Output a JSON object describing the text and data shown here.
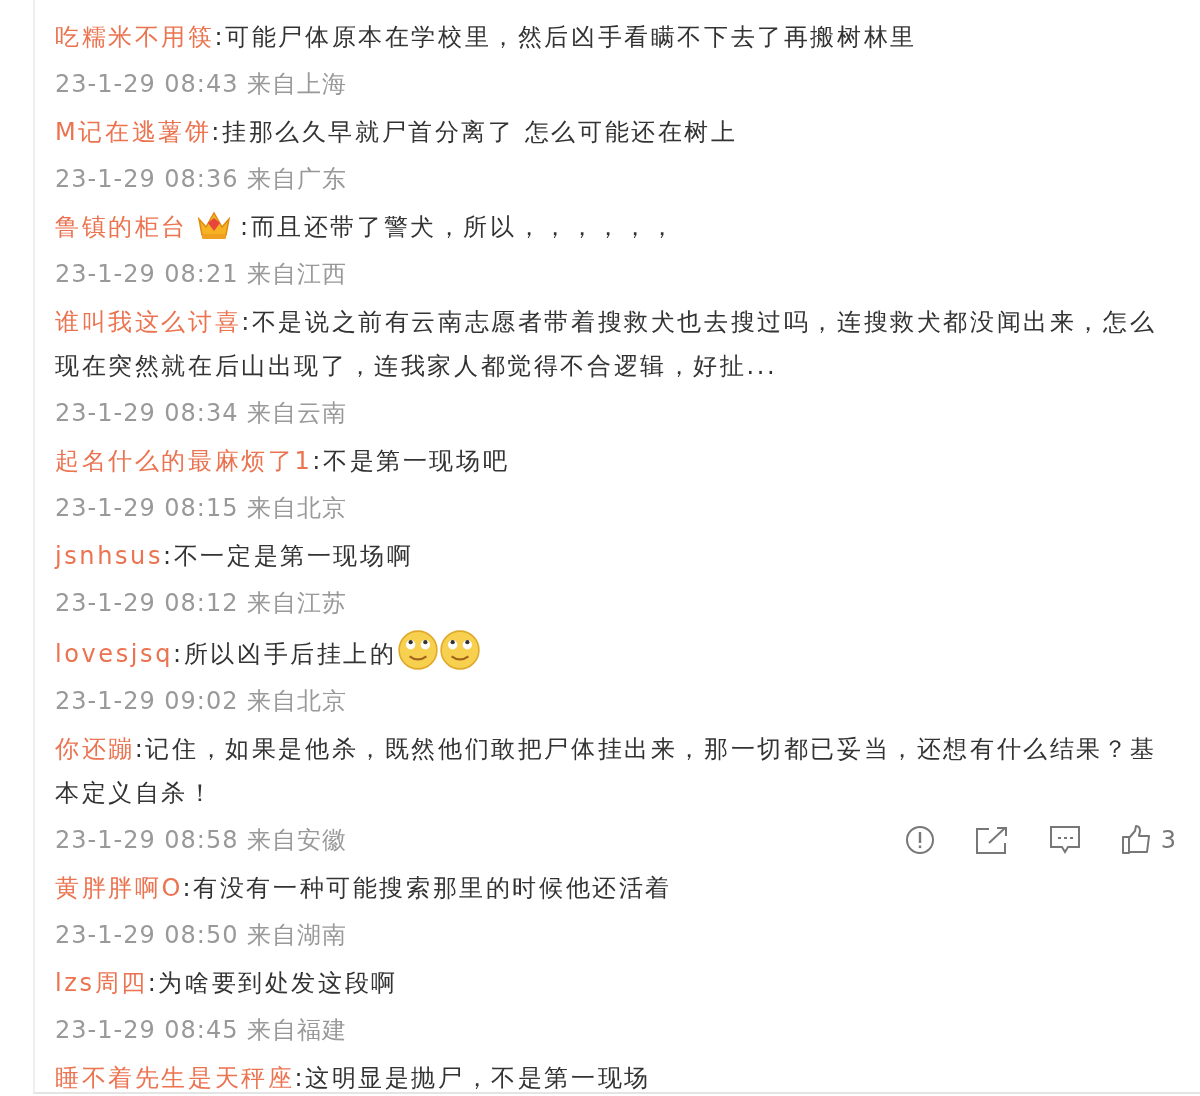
{
  "comments": [
    {
      "author": "吃糯米不用筷",
      "text": ":可能尸体原本在学校里，然后凶手看瞒不下去了再搬树林里",
      "meta": "23-1-29 08:43 来自上海"
    },
    {
      "author": "M记在逃薯饼",
      "text": ":挂那么久早就尸首分离了 怎么可能还在树上",
      "meta": "23-1-29 08:36 来自广东"
    },
    {
      "author": "鲁镇的柜台",
      "badge": {
        "kind": "crown"
      },
      "text": ":而且还带了警犬，所以，，，，，，",
      "meta": "23-1-29 08:21 来自江西"
    },
    {
      "author": "谁叫我这么讨喜",
      "text": ":不是说之前有云南志愿者带着搜救犬也去搜过吗，连搜救犬都没闻出来，怎么现在突然就在后山出现了，连我家人都觉得不合逻辑，好扯...",
      "meta": "23-1-29 08:34 来自云南"
    },
    {
      "author": "起名什么的最麻烦了1",
      "text": ":不是第一现场吧",
      "meta": "23-1-29 08:15 来自北京"
    },
    {
      "author": "jsnhsus",
      "text": ":不一定是第一现场啊",
      "meta": "23-1-29 08:12 来自江苏"
    },
    {
      "author": "lovesjsq",
      "text": ":所以凶手后挂上的",
      "emojis": [
        {
          "kind": "face"
        },
        {
          "kind": "face"
        }
      ],
      "meta": "23-1-29 09:02 来自北京"
    },
    {
      "author": "你还蹦",
      "text": ":记住，如果是他杀，既然他们敢把尸体挂出来，那一切都已妥当，还想有什么结果？基本定义自杀！",
      "meta": "23-1-29 08:58 来自安徽",
      "actions": {
        "like_count": "3"
      }
    },
    {
      "author": "黄胖胖啊O",
      "text": ":有没有一种可能搜索那里的时候他还活着",
      "meta": "23-1-29 08:50 来自湖南"
    },
    {
      "author": "lzs周四",
      "text": ":为啥要到处发这段啊",
      "meta": "23-1-29 08:45 来自福建"
    },
    {
      "author": "睡不着先生是天秤座",
      "text": ":这明显是抛尸，不是第一现场"
    }
  ]
}
